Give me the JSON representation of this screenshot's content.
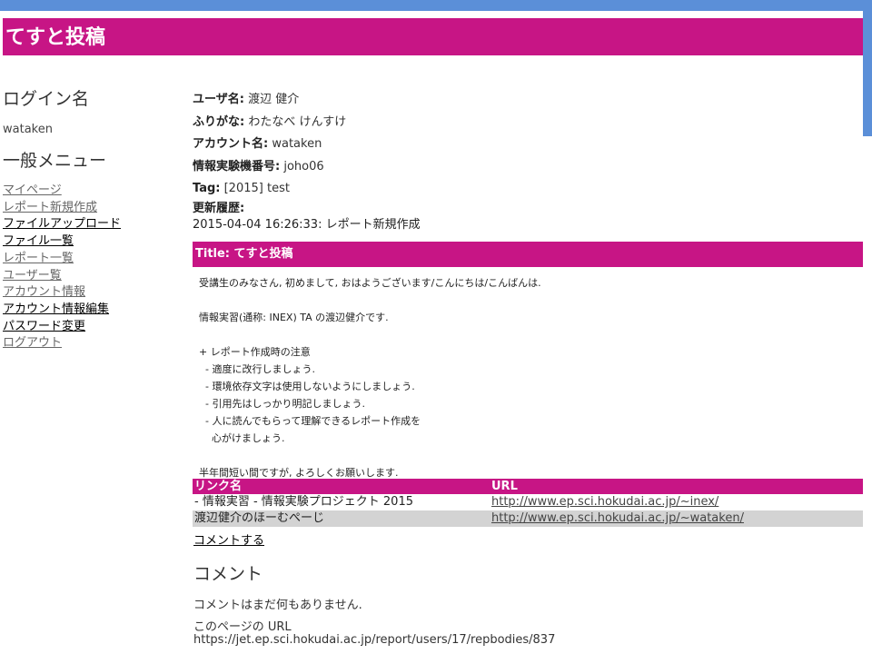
{
  "colors": {
    "accent": "#c71585",
    "frame": "#5b8fd8",
    "row_alt": "#d3d3d3"
  },
  "header": {
    "title": "てすと投稿"
  },
  "sidebar": {
    "login_heading": "ログイン名",
    "login_name": "wataken",
    "menu_heading": "一般メニュー",
    "menu": [
      {
        "label": "マイページ"
      },
      {
        "label": "レポート新規作成"
      },
      {
        "label": "ファイルアップロード"
      },
      {
        "label": "ファイル一覧"
      },
      {
        "label": "レポート一覧"
      },
      {
        "label": "ユーザー覧"
      },
      {
        "label": "アカウント情報"
      },
      {
        "label": "アカウント情報編集"
      },
      {
        "label": "パスワード変更"
      },
      {
        "label": "ログアウト"
      }
    ]
  },
  "profile": {
    "user_name_label": "ユーザ名:",
    "user_name": "渡辺 健介",
    "furigana_label": "ふりがな:",
    "furigana": "わたなべ けんすけ",
    "account_label": "アカウント名:",
    "account": "wataken",
    "machine_label": "情報実験機番号:",
    "machine": "joho06",
    "tag_label": "Tag:",
    "tag": "[2015] test",
    "history_label": "更新履歴:",
    "history": "2015-04-04 16:26:33: レポート新規作成"
  },
  "post": {
    "title_label": "Title:",
    "title": "てすと投稿",
    "body": "受講生のみなさん, 初めまして, おはようございます/こんにちは/こんばんは.\n\n情報実習(通称: INEX) TA の渡辺健介です.\n\n+ レポート作成時の注意\n  - 適度に改行しましょう.\n  - 環境依存文字は使用しないようにしましょう.\n  - 引用先はしっかり明記しましょう.\n  - 人に読んでもらって理解できるレポート作成を\n    心がけましょう.\n\n半年間短い間ですが, よろしくお願いします."
  },
  "links": {
    "headers": {
      "name": "リンク名",
      "url": "URL"
    },
    "rows": [
      {
        "name": "- 情報実習 - 情報実験プロジェクト 2015",
        "url": "http://www.ep.sci.hokudai.ac.jp/~inex/"
      },
      {
        "name": "渡辺健介のほーむぺーじ",
        "url": "http://www.ep.sci.hokudai.ac.jp/~wataken/"
      }
    ]
  },
  "comments": {
    "comment_link": "コメントする",
    "heading": "コメント",
    "empty_text": "コメントはまだ何もありません.",
    "page_url_label": "このページの URL",
    "page_url": "https://jet.ep.sci.hokudai.ac.jp/report/users/17/repbodies/837"
  }
}
